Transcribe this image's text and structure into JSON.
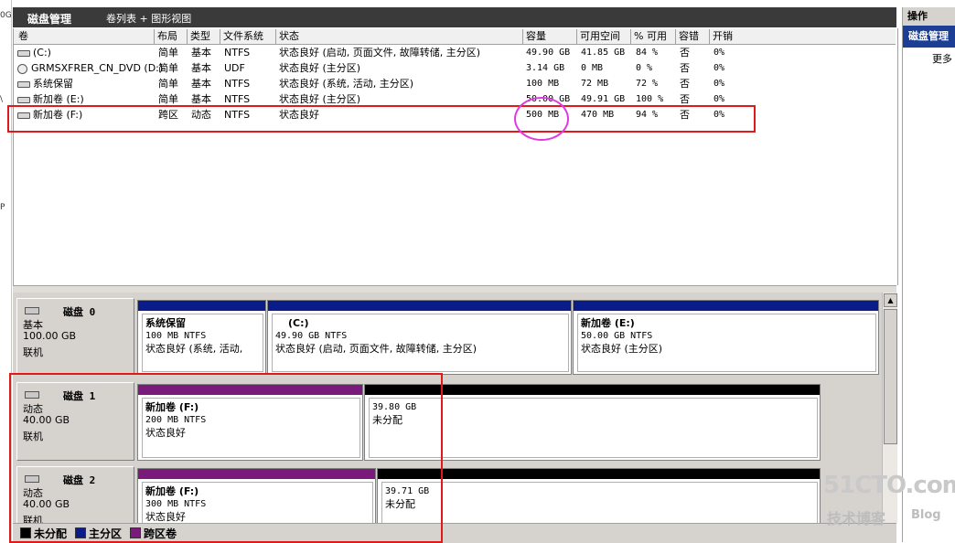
{
  "window": {
    "title": "磁盘管理",
    "view": "卷列表 + 图形视图"
  },
  "left_strip": [
    "0G",
    "\\",
    "P"
  ],
  "columns": [
    "卷",
    "布局",
    "类型",
    "文件系统",
    "状态",
    "容量",
    "可用空间",
    "% 可用",
    "容错",
    "开销"
  ],
  "volumes": [
    {
      "name": "(C:)",
      "layout": "简单",
      "type": "基本",
      "fs": "NTFS",
      "status": "状态良好 (启动, 页面文件, 故障转储, 主分区)",
      "capacity": "49.90 GB",
      "free": "41.85 GB",
      "pct": "84 %",
      "fault": "否",
      "overhead": "0%",
      "icon": "drive-icon"
    },
    {
      "name": "GRMSXFRER_CN_DVD (D:)",
      "layout": "简单",
      "type": "基本",
      "fs": "UDF",
      "status": "状态良好 (主分区)",
      "capacity": "3.14 GB",
      "free": "0 MB",
      "pct": "0 %",
      "fault": "否",
      "overhead": "0%",
      "icon": "cd-icon"
    },
    {
      "name": "系统保留",
      "layout": "简单",
      "type": "基本",
      "fs": "NTFS",
      "status": "状态良好 (系统, 活动, 主分区)",
      "capacity": "100 MB",
      "free": "72 MB",
      "pct": "72 %",
      "fault": "否",
      "overhead": "0%",
      "icon": "drive-icon"
    },
    {
      "name": "新加卷 (E:)",
      "layout": "简单",
      "type": "基本",
      "fs": "NTFS",
      "status": "状态良好 (主分区)",
      "capacity": "50.00 GB",
      "free": "49.91 GB",
      "pct": "100 %",
      "fault": "否",
      "overhead": "0%",
      "icon": "drive-icon"
    },
    {
      "name": "新加卷 (F:)",
      "layout": "跨区",
      "type": "动态",
      "fs": "NTFS",
      "status": "状态良好",
      "capacity": "500 MB",
      "free": "470 MB",
      "pct": "94 %",
      "fault": "否",
      "overhead": "0%",
      "icon": "drive-icon"
    }
  ],
  "disks": [
    {
      "name": "磁盘 0",
      "type": "基本",
      "size": "100.00 GB",
      "state": "联机",
      "partitions": [
        {
          "title": "系统保留",
          "size": "100 MB NTFS",
          "status": "状态良好 (系统, 活动,",
          "bar_color": "#0a1c8a"
        },
        {
          "title": "(C:)",
          "size": "49.90 GB NTFS",
          "status": "状态良好 (启动, 页面文件, 故障转储, 主分区)",
          "bar_color": "#0a1c8a"
        },
        {
          "title": "新加卷  (E:)",
          "size": "50.00 GB NTFS",
          "status": "状态良好 (主分区)",
          "bar_color": "#0a1c8a"
        }
      ]
    },
    {
      "name": "磁盘 1",
      "type": "动态",
      "size": "40.00 GB",
      "state": "联机",
      "partitions": [
        {
          "title": "新加卷  (F:)",
          "size": "200 MB NTFS",
          "status": "状态良好",
          "bar_color": "#7a1a7a"
        },
        {
          "title": "",
          "size": "39.80 GB",
          "status": "未分配",
          "bar_color": "#000000"
        }
      ]
    },
    {
      "name": "磁盘 2",
      "type": "动态",
      "size": "40.00 GB",
      "state": "联机",
      "partitions": [
        {
          "title": "新加卷  (F:)",
          "size": "300 MB NTFS",
          "status": "状态良好",
          "bar_color": "#7a1a7a"
        },
        {
          "title": "",
          "size": "39.71 GB",
          "status": "未分配",
          "bar_color": "#000000"
        }
      ]
    }
  ],
  "legend": [
    {
      "label": "未分配",
      "color": "#000000"
    },
    {
      "label": "主分区",
      "color": "#0a1c8a"
    },
    {
      "label": "跨区卷",
      "color": "#7a1a7a"
    }
  ],
  "actions": {
    "header": "操作",
    "selected": "磁盘管理",
    "more": "更多"
  },
  "watermark": {
    "site": "51CTO.com",
    "sub": "技术博客",
    "blog": "Blog"
  },
  "colors": {
    "highlight_box": "#e01a1a",
    "circle": "#e238e2"
  }
}
